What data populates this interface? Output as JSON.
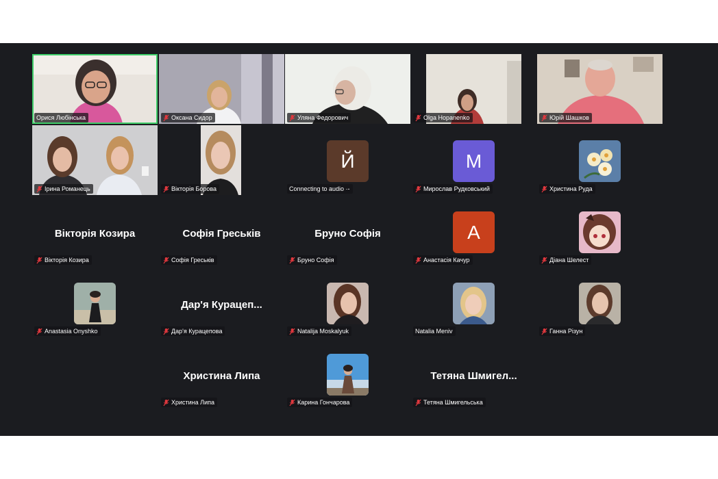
{
  "participants": [
    {
      "name": "Орися Любінська",
      "muted": true,
      "tile": "video",
      "active": true
    },
    {
      "name": "Оксана Сидор",
      "muted": true,
      "tile": "video"
    },
    {
      "name": "Уляна Федорович",
      "muted": true,
      "tile": "video"
    },
    {
      "name": "Olga Hopanenko",
      "muted": true,
      "tile": "video"
    },
    {
      "name": "Юрій Шашков",
      "muted": true,
      "tile": "video"
    },
    {
      "name": "Ірина Романець",
      "muted": true,
      "tile": "video"
    },
    {
      "name": "Вікторія Борова",
      "muted": true,
      "tile": "video"
    },
    {
      "name": "Connecting to audio ·-",
      "muted": false,
      "tile": "letter",
      "letter": "Й",
      "color": "#5b3a2a"
    },
    {
      "name": "Мирослав Рудковський",
      "muted": true,
      "tile": "letter",
      "letter": "M",
      "color": "#6a5bd6"
    },
    {
      "name": "Христина Руда",
      "muted": true,
      "tile": "photo",
      "icon": "flower-photo-icon"
    },
    {
      "name": "Вікторія Козира",
      "muted": true,
      "tile": "name",
      "display": "Вікторія Козира"
    },
    {
      "name": "Софія Греськів",
      "muted": true,
      "tile": "name",
      "display": "Софія Греськів"
    },
    {
      "name": "Бруно Софія",
      "muted": true,
      "tile": "name",
      "display": "Бруно Софія"
    },
    {
      "name": "Анастасія Качур",
      "muted": true,
      "tile": "letter",
      "letter": "A",
      "color": "#c8401c"
    },
    {
      "name": "Діана Шелест",
      "muted": true,
      "tile": "photo",
      "icon": "anime-avatar-icon"
    },
    {
      "name": "Anastasia Onyshko",
      "muted": true,
      "tile": "photo",
      "icon": "person-photo-icon"
    },
    {
      "name": "Дар'я Курацепова",
      "muted": true,
      "tile": "name",
      "display": "Дар'я  Курацеп..."
    },
    {
      "name": "Natalija Moskalyuk",
      "muted": true,
      "tile": "photo",
      "icon": "person-photo-icon"
    },
    {
      "name": "Natalia Meniv",
      "muted": false,
      "tile": "photo",
      "icon": "person-photo-icon"
    },
    {
      "name": "Ганна Різун",
      "muted": true,
      "tile": "photo",
      "icon": "person-photo-icon"
    },
    {
      "name": "Христина Липа",
      "muted": true,
      "tile": "name",
      "display": "Христина Липа"
    },
    {
      "name": "Карина Гончарова",
      "muted": true,
      "tile": "photo",
      "icon": "person-photo-icon"
    },
    {
      "name": "Тетяна Шмигельська",
      "muted": true,
      "tile": "name",
      "display": "Тетяна  Шмигел..."
    }
  ],
  "colors": {
    "stage_bg": "#1b1c20",
    "active_speaker_border": "#3fcf6a",
    "muted_mic": "#e0383e"
  }
}
